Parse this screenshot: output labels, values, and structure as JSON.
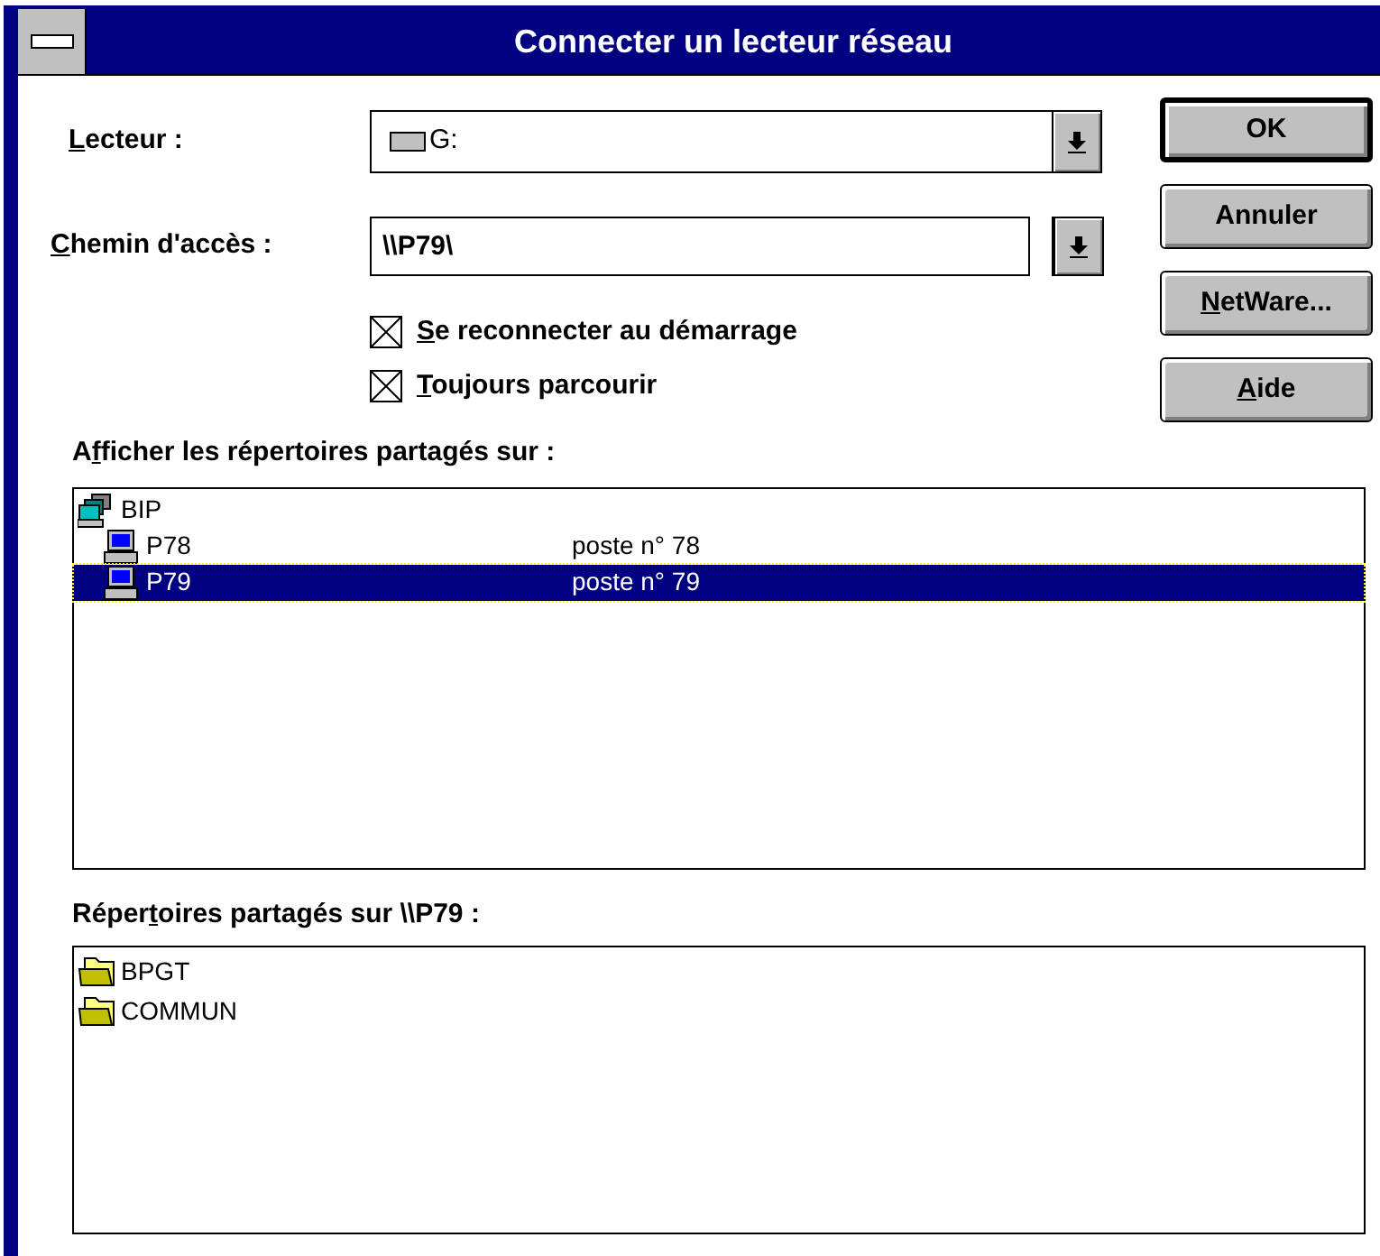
{
  "window": {
    "title": "Connecter un lecteur réseau"
  },
  "drive": {
    "label": {
      "key": "L",
      "post": "ecteur :"
    },
    "value": "G:"
  },
  "path": {
    "label": {
      "key": "C",
      "post": "hemin d'accès :"
    },
    "value": "\\\\P79\\"
  },
  "options": [
    {
      "label": {
        "key": "S",
        "post": "e reconnecter au démarrage"
      },
      "checked": true
    },
    {
      "label": {
        "key": "T",
        "post": "oujours parcourir"
      },
      "checked": true
    }
  ],
  "buttons": [
    {
      "label": {
        "post": "OK"
      },
      "default": true
    },
    {
      "label": {
        "post": "Annuler"
      },
      "default": false
    },
    {
      "label": {
        "key": "N",
        "post": "etWare..."
      },
      "default": false
    },
    {
      "label": {
        "key": "A",
        "post": "ide"
      },
      "default": false
    }
  ],
  "computers": {
    "label": {
      "pre": "A",
      "key": "f",
      "post": "ficher les répertoires partagés sur :"
    },
    "items": [
      {
        "kind": "network",
        "name": "BIP",
        "selected": false,
        "children": [
          {
            "kind": "computer",
            "name": "P78",
            "comment": "poste n° 78",
            "selected": false
          },
          {
            "kind": "computer",
            "name": "P79",
            "comment": "poste n° 79",
            "selected": true
          }
        ]
      }
    ]
  },
  "shares": {
    "label": {
      "pre": "Réper",
      "key": "t",
      "post": "oires partagés sur \\\\P79 :"
    },
    "items": [
      {
        "kind": "folder",
        "name": "BPGT"
      },
      {
        "kind": "folder",
        "name": "COMMUN"
      }
    ]
  }
}
